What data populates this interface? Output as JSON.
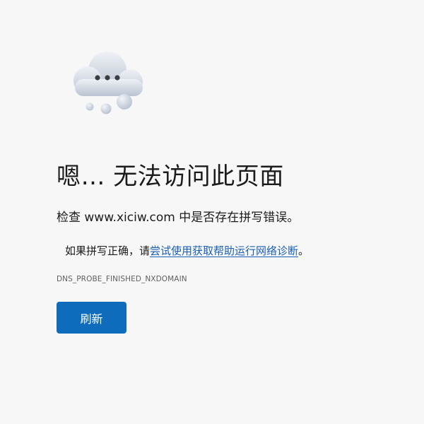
{
  "error": {
    "headline": "嗯… 无法访问此页面",
    "check_prefix": "检查 ",
    "domain": "www.xiciw.com",
    "check_suffix": " 中是否存在拼写错误。",
    "suggestion_prefix": "如果拼写正确，请",
    "suggestion_link": "尝试使用获取帮助运行网络诊断",
    "suggestion_suffix": "。",
    "code": "DNS_PROBE_FINISHED_NXDOMAIN",
    "refresh_label": "刷新"
  },
  "icons": {
    "illustration": "cloud-thinking-icon"
  },
  "colors": {
    "background": "#f7f7f7",
    "accent": "#0f6cbd",
    "link": "#1a5fb4",
    "text": "#1b1b1b",
    "muted": "#5f5f5f"
  }
}
